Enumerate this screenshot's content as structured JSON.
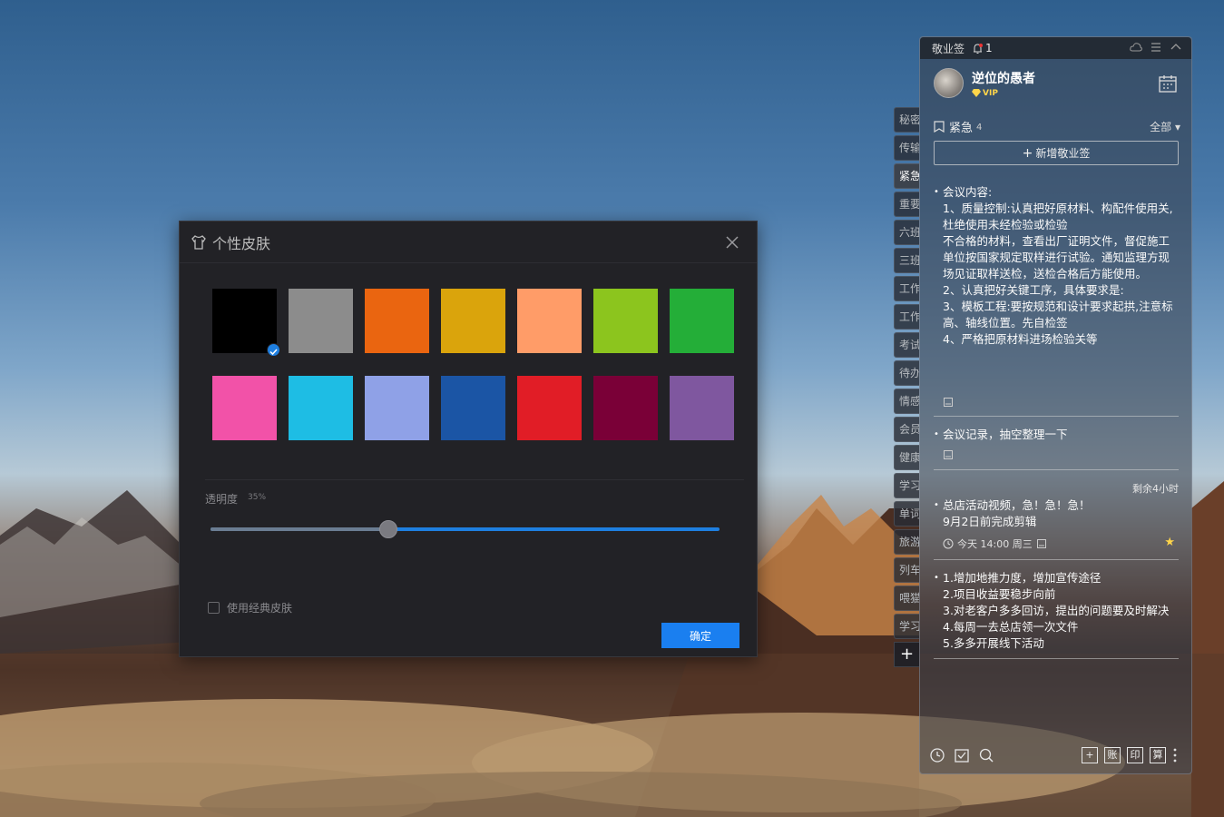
{
  "dialog": {
    "title": "个性皮肤",
    "swatch_colors": [
      "#000000",
      "#8c8c8c",
      "#ea6510",
      "#daa40c",
      "#ff9c68",
      "#8cc51e",
      "#24ae38",
      "#f252a8",
      "#1ebde4",
      "#8fa1e7",
      "#1b55a5",
      "#e11d26",
      "#7a0037",
      "#7f579f"
    ],
    "selected_swatch": 0,
    "opacity_label": "透明度",
    "opacity_value": "35%",
    "opacity_fraction": 0.35,
    "classic_skin_label": "使用经典皮肤",
    "classic_skin_checked": false,
    "confirm_label": "确定",
    "accent": "#1a7ff0"
  },
  "side_tabs": {
    "items": [
      "秘密",
      "传输",
      "紧急",
      "重要",
      "六班",
      "三班",
      "工作",
      "工作",
      "考试",
      "待办",
      "情感",
      "会员",
      "健康",
      "学习",
      "单词",
      "旅游",
      "列车",
      "喂猫",
      "学习"
    ],
    "active_index": 2,
    "add_label": "+"
  },
  "panel": {
    "app_name": "敬业签",
    "notification_count": "1",
    "user_name": "逆位的愚者",
    "vip_label": "VIP",
    "category_name": "紧急",
    "category_count": "4",
    "filter_label": "全部",
    "new_note_label": "新增敬业签",
    "notes": [
      {
        "lines": [
          "会议内容:",
          "1、质量控制:认真把好原材料、构配件使用关,杜绝使用未经检验或检验",
          "不合格的材料，查看出厂证明文件，督促施工单位按国家规定取样进行试验。通知监理方现场见证取样送检，送检合格后方能使用。",
          "2、认真把好关键工序，具体要求是:",
          "3、模板工程:要按规范和设计要求起拱,注意标高、轴线位置。先自检签",
          "4、严格把原材料进场检验关等"
        ]
      },
      {
        "lines": [
          "会议记录，抽空整理一下"
        ]
      },
      {
        "remaining": "剩余4小时",
        "lines": [
          "总店活动视频，急！急！急！",
          "9月2日前完成剪辑"
        ],
        "meta": "今天 14:00 周三"
      },
      {
        "lines": [
          "1.增加地推力度，增加宣传途径",
          "2.项目收益要稳步向前",
          "3.对老客户多多回访，提出的问题要及时解决",
          "4.每周一去总店领一次文件",
          "5.多多开展线下活动"
        ]
      }
    ],
    "bottom_buttons": [
      "账",
      "印",
      "算"
    ]
  }
}
